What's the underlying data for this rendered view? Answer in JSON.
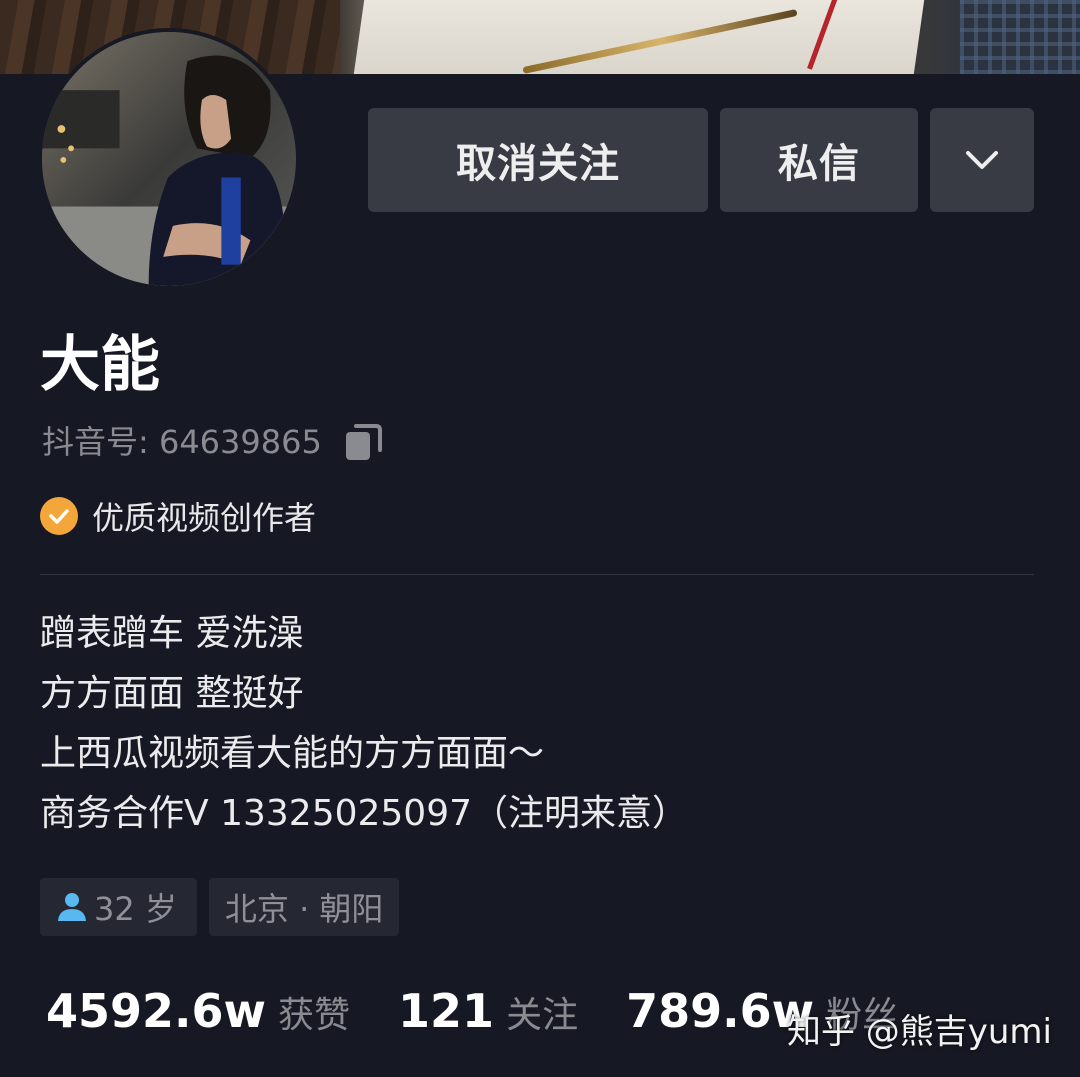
{
  "actions": {
    "unfollow_label": "取消关注",
    "message_label": "私信",
    "more_icon": "chevron-down-icon"
  },
  "profile": {
    "nickname": "大能",
    "douyin_id": "抖音号: 64639865",
    "verified_label": "优质视频创作者",
    "verified_color": "#f3a73a"
  },
  "bio": {
    "lines": [
      "蹭表蹭车 爱洗澡",
      "方方面面 整挺好",
      "上西瓜视频看大能的方方面面～",
      "商务合作V 13325025097（注明来意）"
    ]
  },
  "tags": {
    "age": "32 岁",
    "location": "北京 · 朝阳"
  },
  "stats": {
    "likes_num": "4592.6w",
    "likes_label": "获赞",
    "following_num": "121",
    "following_label": "关注",
    "followers_num": "789.6w",
    "followers_label": "粉丝"
  },
  "watermark": "知乎 @熊吉yumi",
  "colors": {
    "background": "#161823",
    "button_bg": "#393b44",
    "tag_bg": "#252732",
    "secondary_text": "#8a8b91",
    "age_icon": "#5ab8f0"
  }
}
